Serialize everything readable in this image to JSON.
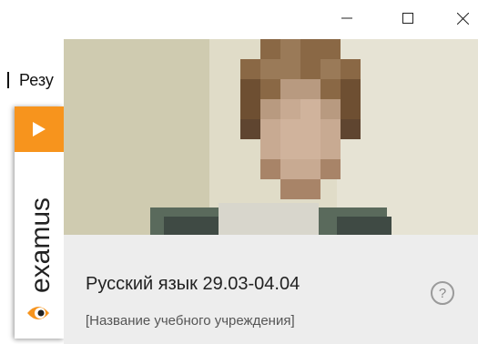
{
  "window": {
    "minimize_icon": "minimize-icon",
    "maximize_icon": "maximize-icon",
    "close_icon": "close-icon"
  },
  "background": {
    "text": "Резу"
  },
  "sidebar": {
    "play_icon": "play-icon",
    "brand_text": "examus",
    "brand_icon": "examus-eye-logo",
    "accent_color": "#f7941d"
  },
  "popup": {
    "course_title": "Русский язык 29.03-04.04",
    "institution": "[Название учебного учреждения]",
    "help_icon": "help-circle-icon",
    "help_glyph": "?"
  }
}
